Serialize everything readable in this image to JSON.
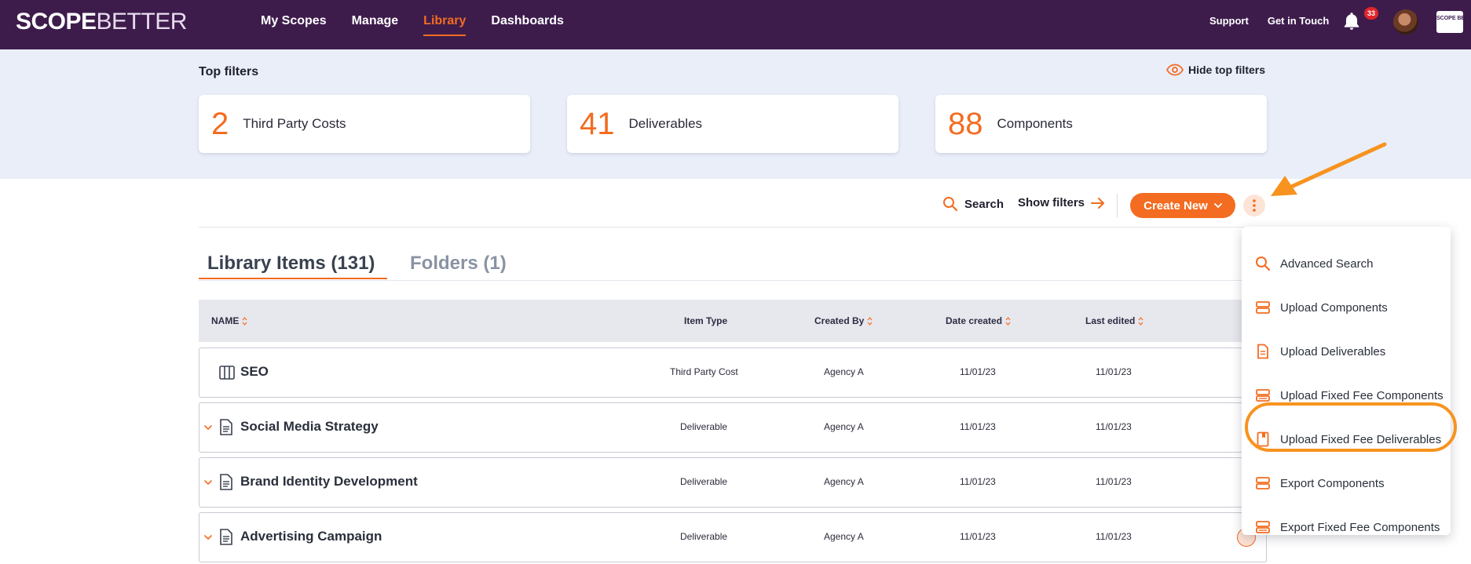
{
  "header": {
    "logo_bold": "SCOPE",
    "logo_thin": "BETTER",
    "nav": [
      {
        "label": "My Scopes",
        "active": false
      },
      {
        "label": "Manage",
        "active": false
      },
      {
        "label": "Library",
        "active": true
      },
      {
        "label": "Dashboards",
        "active": false
      }
    ],
    "support": "Support",
    "get_in_touch": "Get in Touch",
    "notification_count": "33",
    "mini_logo": "SCOPE BETTER"
  },
  "filters": {
    "title": "Top filters",
    "hide_label": "Hide top filters",
    "cards": [
      {
        "count": "2",
        "label": "Third Party Costs"
      },
      {
        "count": "41",
        "label": "Deliverables"
      },
      {
        "count": "88",
        "label": "Components"
      }
    ]
  },
  "toolbar": {
    "search": "Search",
    "show_filters": "Show filters",
    "create_new": "Create New"
  },
  "tabs": {
    "items": "Library Items (131)",
    "folders": "Folders (1)"
  },
  "table": {
    "headers": {
      "name": "NAME",
      "item_type": "Item Type",
      "created_by": "Created By",
      "date_created": "Date created",
      "last_edited": "Last edited"
    },
    "rows": [
      {
        "name": "SEO",
        "type": "Third Party Cost",
        "created_by": "Agency A",
        "date_created": "11/01/23",
        "last_edited": "11/01/23",
        "icon": "columns-icon"
      },
      {
        "name": "Social Media Strategy",
        "type": "Deliverable",
        "created_by": "Agency A",
        "date_created": "11/01/23",
        "last_edited": "11/01/23",
        "icon": "document-icon"
      },
      {
        "name": "Brand Identity Development",
        "type": "Deliverable",
        "created_by": "Agency A",
        "date_created": "11/01/23",
        "last_edited": "11/01/23",
        "icon": "document-icon"
      },
      {
        "name": "Advertising Campaign",
        "type": "Deliverable",
        "created_by": "Agency A",
        "date_created": "11/01/23",
        "last_edited": "11/01/23",
        "icon": "document-icon"
      }
    ]
  },
  "menu": {
    "items": [
      "Advanced Search",
      "Upload Components",
      "Upload Deliverables",
      "Upload Fixed Fee Components",
      "Upload Fixed Fee Deliverables",
      "Export Components",
      "Export Fixed Fee Components"
    ]
  },
  "colors": {
    "header_bg": "#3d1c4c",
    "accent": "#f36c21",
    "annotation": "#f7931e",
    "filter_band": "#e9eef8"
  }
}
